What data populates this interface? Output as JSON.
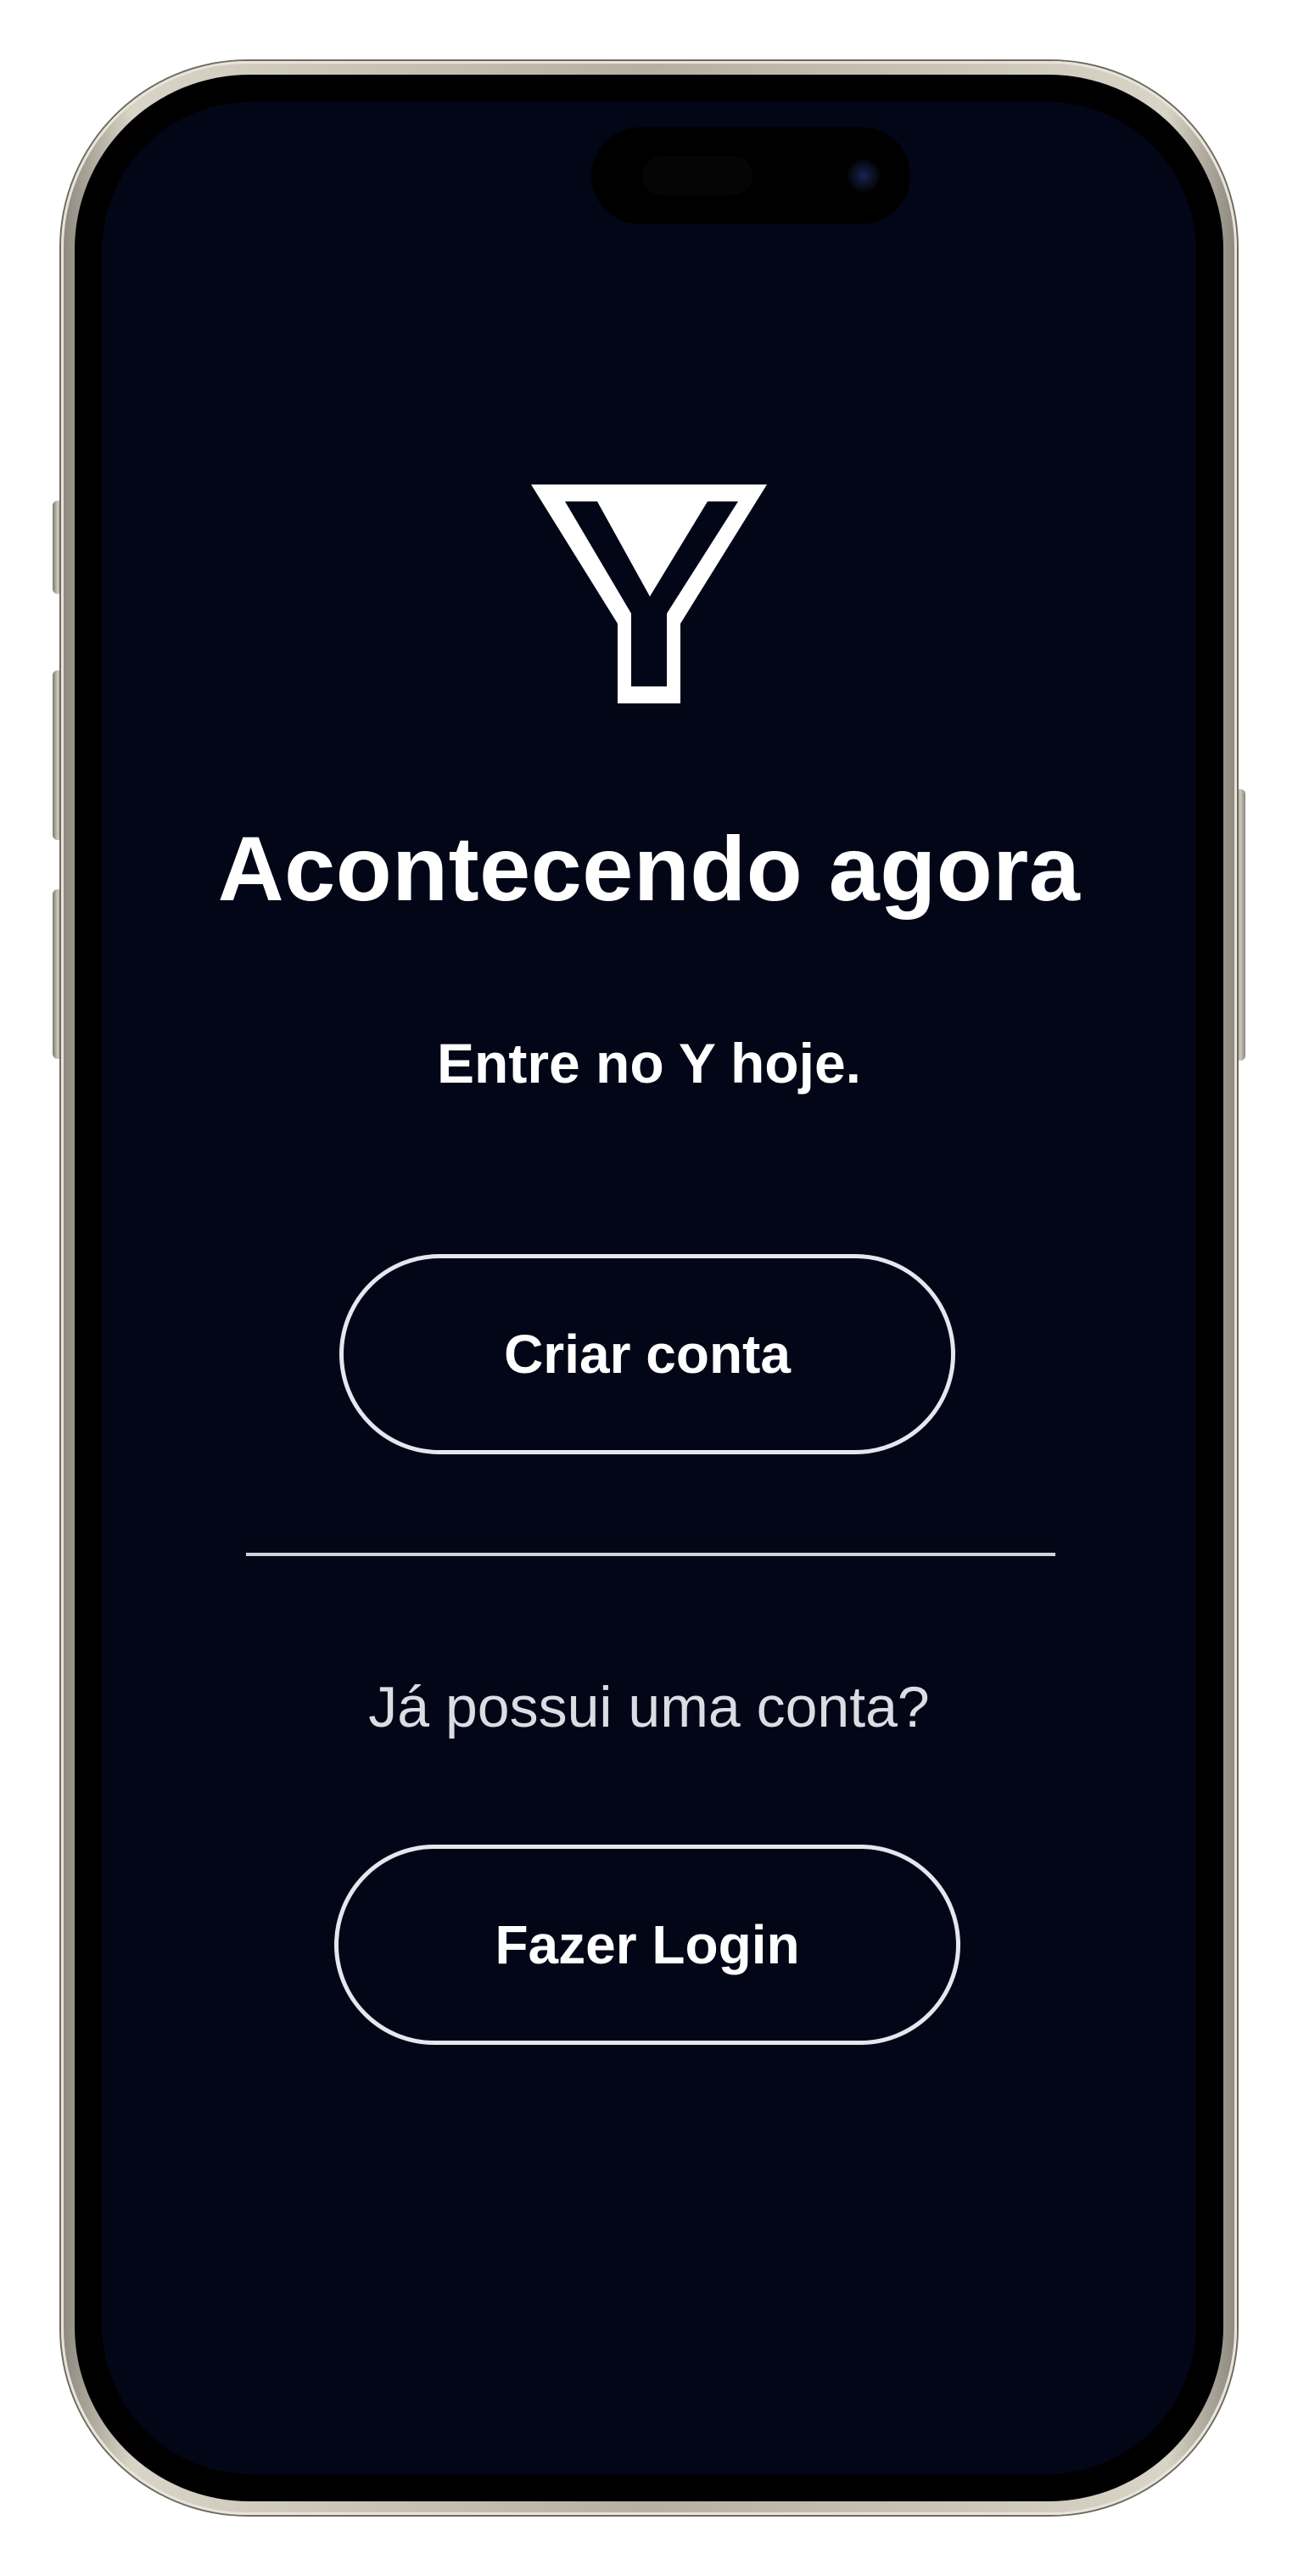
{
  "app": {
    "logo_icon": "y-logo-icon"
  },
  "welcome": {
    "title": "Acontecendo agora",
    "subtitle": "Entre no Y hoje.",
    "create_account_label": "Criar conta",
    "has_account_question": "Já possui uma conta?",
    "login_label": "Fazer Login"
  },
  "colors": {
    "background": "#030616",
    "text": "#ffffff",
    "button_border": "#e6e6ee"
  }
}
